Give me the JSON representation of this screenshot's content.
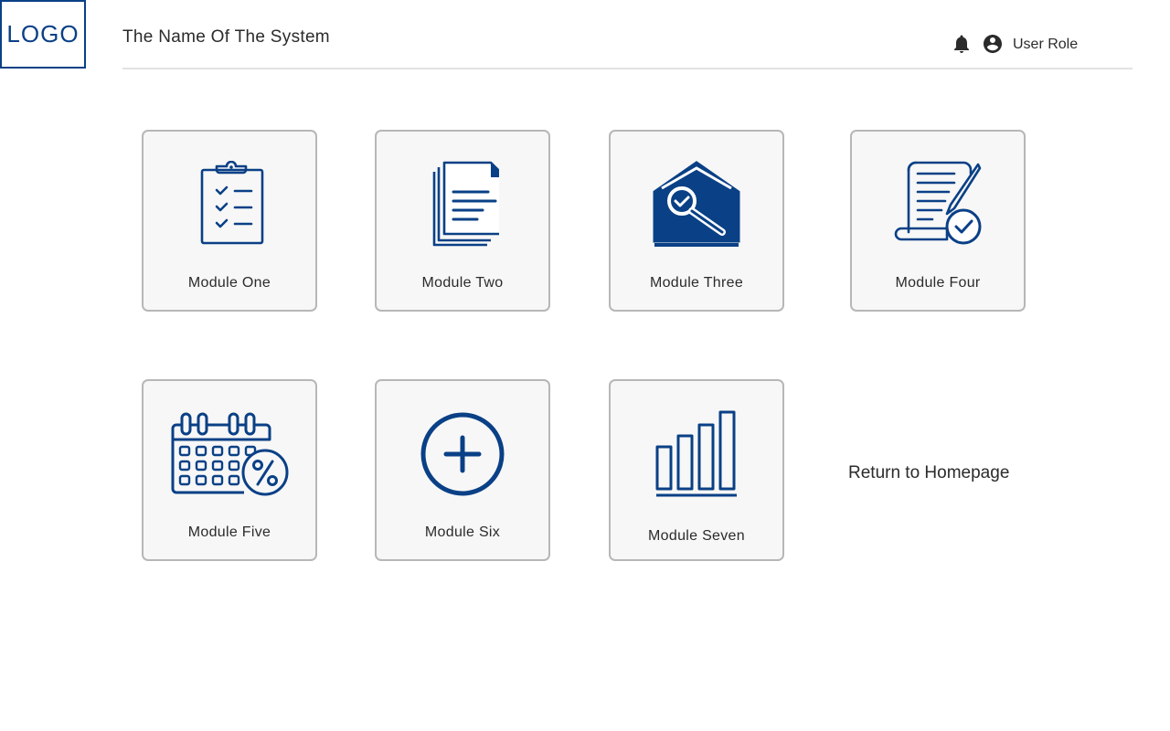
{
  "header": {
    "logo_text": "LOGO",
    "system_title": "The Name Of The System",
    "notification_icon": "bell-icon",
    "user_icon": "account-circle-icon",
    "user_role": "User Role"
  },
  "modules": [
    {
      "label": "Module One",
      "icon": "clipboard-checklist-icon"
    },
    {
      "label": "Module Two",
      "icon": "documents-stack-icon"
    },
    {
      "label": "Module Three",
      "icon": "house-search-icon"
    },
    {
      "label": "Module Four",
      "icon": "scroll-signed-certificate-icon"
    },
    {
      "label": "Module Five",
      "icon": "calendar-percent-icon"
    },
    {
      "label": "Module Six",
      "icon": "plus-circle-icon"
    },
    {
      "label": "Module Seven",
      "icon": "bar-chart-icon"
    }
  ],
  "return_link": "Return to Homepage",
  "colors": {
    "accent": "#0a4086",
    "card_background": "#f7f7f7",
    "card_border": "#b7b7b7",
    "text": "#2b2b2b"
  }
}
